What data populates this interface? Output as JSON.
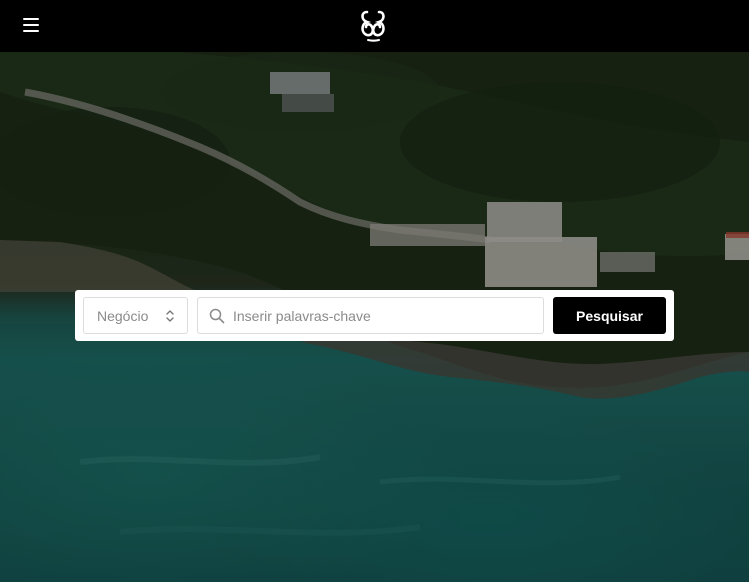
{
  "header": {
    "menu_icon": "hamburger-menu-icon",
    "logo_icon": "brand-monogram-logo"
  },
  "search": {
    "business_select": {
      "selected": "Negócio",
      "icon": "chevron-up-down-icon"
    },
    "keywords": {
      "placeholder": "Inserir palavras-chave",
      "value": "",
      "icon": "search-icon"
    },
    "submit_label": "Pesquisar"
  },
  "hero": {
    "image_description_icon": "coastal-aerial-photo",
    "colors": {
      "sea": "#1b625e",
      "forest": "#22321d",
      "topbar": "#000000"
    }
  }
}
